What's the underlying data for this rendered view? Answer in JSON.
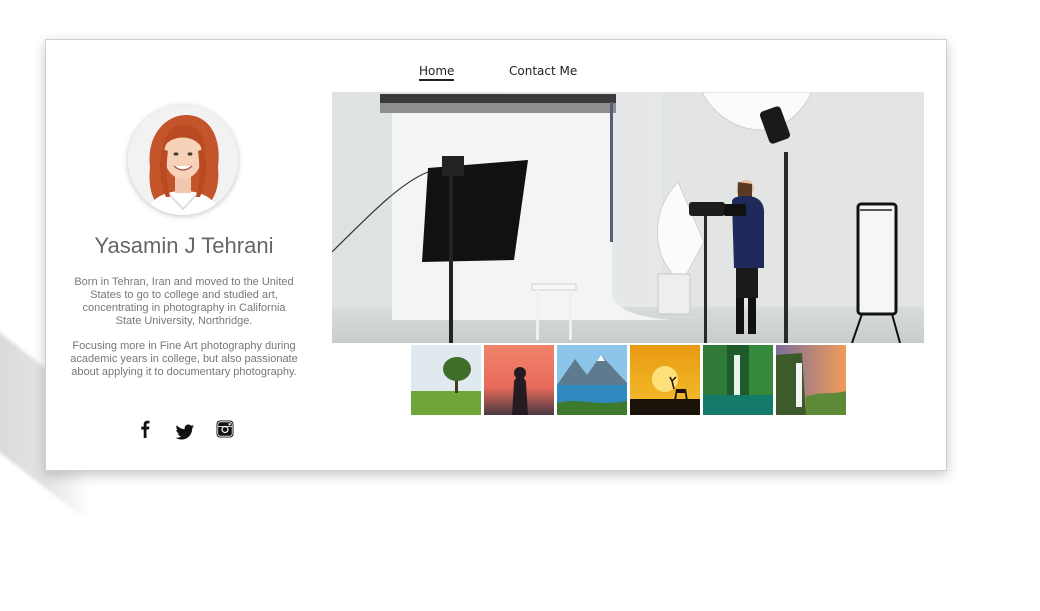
{
  "nav": {
    "home_label": "Home",
    "contact_label": "Contact Me"
  },
  "profile": {
    "name": "Yasamin J Tehrani",
    "bio_paragraph_1": "Born in Tehran, Iran and moved to the United States to go to college and studied art, concentrating in photography in California State University, Northridge.",
    "bio_paragraph_2": "Focusing more in Fine Art photography during academic years in college, but also passionate about applying it to documentary photography."
  },
  "social": {
    "icons": [
      "facebook-icon",
      "twitter-icon",
      "instagram-icon"
    ]
  },
  "gallery": {
    "hero_image": "photo-studio-image",
    "thumbnails": [
      "tree-field-thumbnail",
      "silhouette-sunset-thumbnail",
      "mountain-lake-thumbnail",
      "deer-sunset-thumbnail",
      "waterfall-forest-thumbnail",
      "cliff-waterfall-thumbnail"
    ]
  },
  "colors": {
    "name_text": "#666666",
    "bio_text": "#777777",
    "nav_text": "#222222",
    "card_border": "#cfcfcf"
  }
}
